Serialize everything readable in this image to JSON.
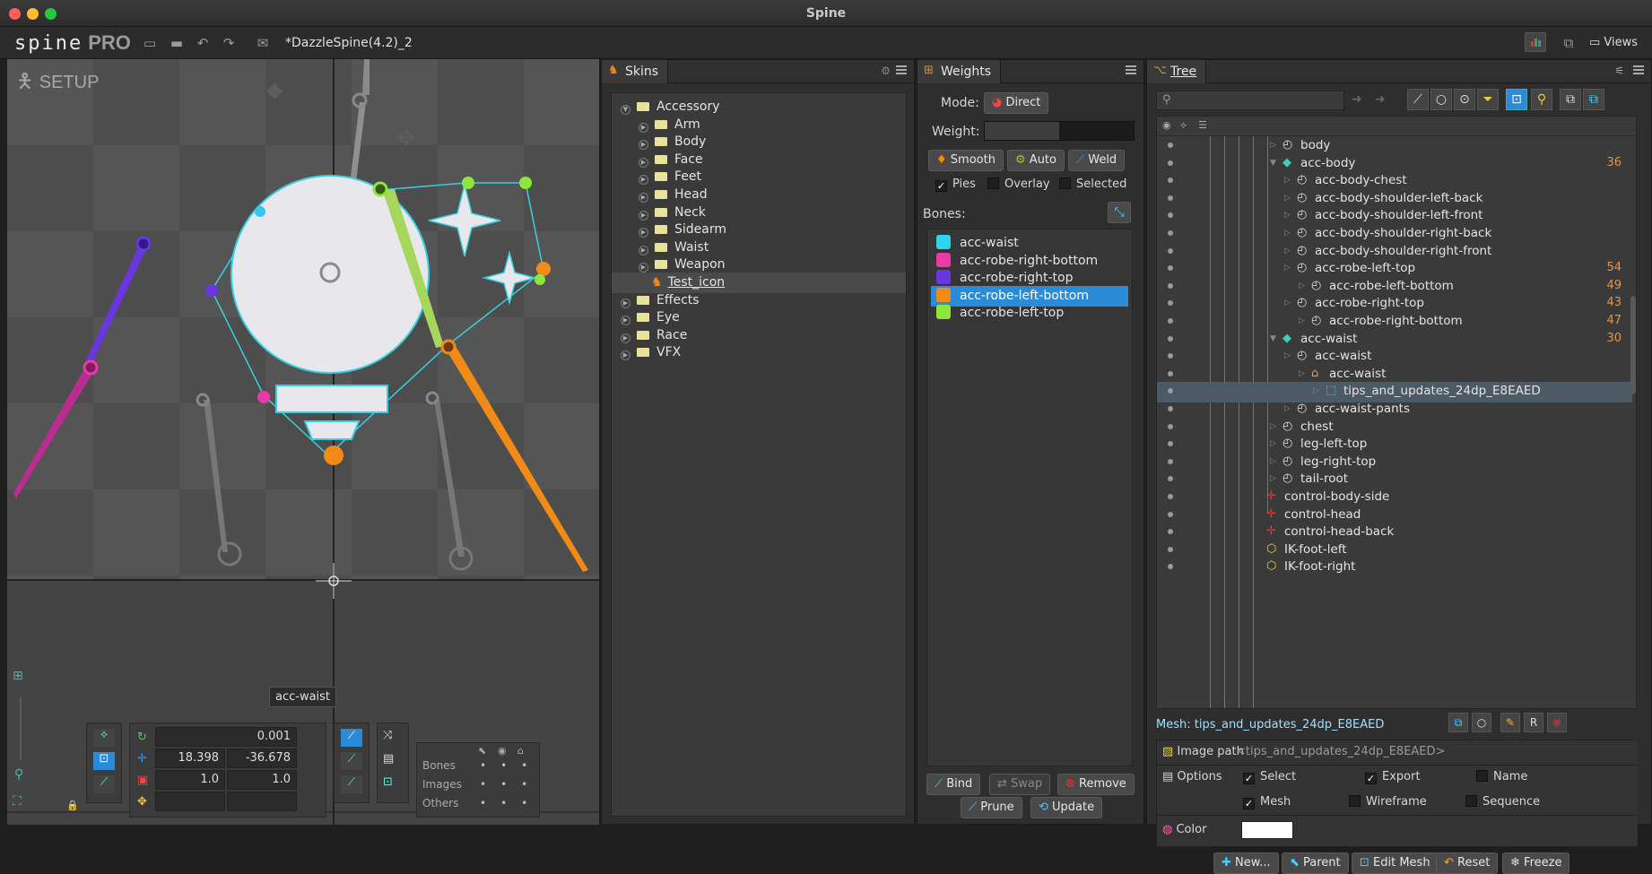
{
  "window": {
    "title": "Spine",
    "colors": {
      "close": "#fe5f57",
      "minimize": "#febc2e",
      "maximize": "#28c840",
      "accent": "#2a8bd8"
    }
  },
  "toolbar": {
    "logo": "spine",
    "logo_pro": "PRO",
    "filename": "*DazzleSpine(4.2)_2",
    "views_label": "Views",
    "icons": [
      "folder-icon",
      "save-icon",
      "undo-icon",
      "redo-icon",
      "mail-icon"
    ]
  },
  "viewport": {
    "mode_label": "SETUP",
    "bone_tooltip": "acc-waist",
    "transform": {
      "rotate": "0.001",
      "translate_x": "18.398",
      "translate_y": "-36.678",
      "scale_x": "1.0",
      "scale_y": "1.0"
    },
    "visibility": {
      "rows": [
        "Bones",
        "Images",
        "Others"
      ]
    }
  },
  "skins": {
    "tab": "Skins",
    "items": [
      {
        "label": "Accessory",
        "type": "folder",
        "open": true
      },
      {
        "label": "Arm",
        "type": "folder"
      },
      {
        "label": "Body",
        "type": "folder"
      },
      {
        "label": "Face",
        "type": "folder"
      },
      {
        "label": "Feet",
        "type": "folder"
      },
      {
        "label": "Head",
        "type": "folder"
      },
      {
        "label": "Neck",
        "type": "folder"
      },
      {
        "label": "Sidearm",
        "type": "folder"
      },
      {
        "label": "Waist",
        "type": "folder"
      },
      {
        "label": "Weapon",
        "type": "folder"
      },
      {
        "label": "Test_icon",
        "type": "skin",
        "selected": true
      },
      {
        "label": "Effects",
        "type": "folder"
      },
      {
        "label": "Eye",
        "type": "folder"
      },
      {
        "label": "Race",
        "type": "folder"
      },
      {
        "label": "VFX",
        "type": "folder"
      }
    ]
  },
  "weights": {
    "tab": "Weights",
    "mode_label": "Mode:",
    "mode_value": "Direct",
    "weight_label": "Weight:",
    "weight_fraction": 0.5,
    "buttons": {
      "smooth": "Smooth",
      "auto": "Auto",
      "weld": "Weld",
      "bind": "Bind",
      "swap": "Swap",
      "remove": "Remove",
      "prune": "Prune",
      "update": "Update"
    },
    "checks": {
      "pies": "Pies",
      "overlay": "Overlay",
      "selected": "Selected"
    },
    "bones_label": "Bones:",
    "bones": [
      {
        "name": "acc-waist",
        "color": "#2fd4ee"
      },
      {
        "name": "acc-robe-right-bottom",
        "color": "#e83aa8"
      },
      {
        "name": "acc-robe-right-top",
        "color": "#6a36e0"
      },
      {
        "name": "acc-robe-left-bottom",
        "color": "#f28a16",
        "selected": true
      },
      {
        "name": "acc-robe-left-top",
        "color": "#8ee63c"
      }
    ]
  },
  "tree": {
    "tab": "Tree",
    "rows": [
      {
        "label": "body",
        "kind": "bone",
        "indent": 0,
        "count": ""
      },
      {
        "label": "acc-body",
        "kind": "skin",
        "indent": 0,
        "count": "36"
      },
      {
        "label": "acc-body-chest",
        "kind": "bone",
        "indent": 1,
        "count": ""
      },
      {
        "label": "acc-body-shoulder-left-back",
        "kind": "bone",
        "indent": 1,
        "count": ""
      },
      {
        "label": "acc-body-shoulder-left-front",
        "kind": "bone",
        "indent": 1,
        "count": ""
      },
      {
        "label": "acc-body-shoulder-right-back",
        "kind": "bone",
        "indent": 1,
        "count": ""
      },
      {
        "label": "acc-body-shoulder-right-front",
        "kind": "bone",
        "indent": 1,
        "count": ""
      },
      {
        "label": "acc-robe-left-top",
        "kind": "bone",
        "indent": 1,
        "count": "54"
      },
      {
        "label": "acc-robe-left-bottom",
        "kind": "bone",
        "indent": 2,
        "count": "49"
      },
      {
        "label": "acc-robe-right-top",
        "kind": "bone",
        "indent": 1,
        "count": "43"
      },
      {
        "label": "acc-robe-right-bottom",
        "kind": "bone",
        "indent": 2,
        "count": "47"
      },
      {
        "label": "acc-waist",
        "kind": "skin",
        "indent": 0,
        "count": "30"
      },
      {
        "label": "acc-waist",
        "kind": "bone",
        "indent": 1,
        "count": ""
      },
      {
        "label": "acc-waist",
        "kind": "slot",
        "indent": 2,
        "count": ""
      },
      {
        "label": "tips_and_updates_24dp_E8EAED",
        "kind": "mesh",
        "indent": 3,
        "count": "",
        "selected": true
      },
      {
        "label": "acc-waist-pants",
        "kind": "bone",
        "indent": 1,
        "count": ""
      },
      {
        "label": "chest",
        "kind": "bone",
        "indent": -1,
        "count": ""
      },
      {
        "label": "leg-left-top",
        "kind": "bone",
        "indent": -1,
        "count": ""
      },
      {
        "label": "leg-right-top",
        "kind": "bone",
        "indent": -1,
        "count": ""
      },
      {
        "label": "tail-root",
        "kind": "bone",
        "indent": -1,
        "count": ""
      },
      {
        "label": "control-body-side",
        "kind": "control",
        "indent": -2,
        "count": ""
      },
      {
        "label": "control-head",
        "kind": "control",
        "indent": -2,
        "count": ""
      },
      {
        "label": "control-head-back",
        "kind": "control",
        "indent": -2,
        "count": ""
      },
      {
        "label": "IK-foot-left",
        "kind": "ik",
        "indent": -2,
        "count": ""
      },
      {
        "label": "IK-foot-right",
        "kind": "ik",
        "indent": -2,
        "count": ""
      }
    ]
  },
  "mesh": {
    "title": "Mesh: tips_and_updates_24dp_E8EAED",
    "image_path_label": "Image path",
    "image_path_value": "<tips_and_updates_24dp_E8EAED>",
    "options_label": "Options",
    "select": "Select",
    "export": "Export",
    "name": "Name",
    "mesh": "Mesh",
    "wireframe": "Wireframe",
    "sequence": "Sequence",
    "color_label": "Color",
    "color_value": "#ffffff",
    "buttons": {
      "new": "New...",
      "parent": "Parent",
      "edit_mesh": "Edit Mesh",
      "reset": "Reset",
      "freeze": "Freeze"
    }
  }
}
